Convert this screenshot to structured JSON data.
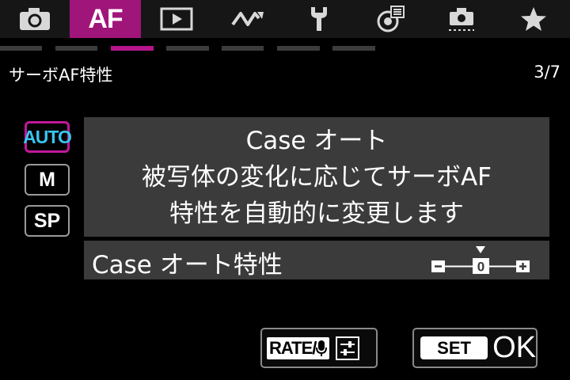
{
  "tabs": [
    {
      "icon": "camera-icon"
    },
    {
      "label": "AF",
      "active": true
    },
    {
      "icon": "playback-icon"
    },
    {
      "icon": "wave-icon"
    },
    {
      "icon": "wrench-icon"
    },
    {
      "icon": "custom-functions-icon"
    },
    {
      "icon": "my-menu-icon"
    },
    {
      "icon": "star-icon"
    }
  ],
  "header": {
    "title": "サーボAF特性",
    "page": "3/7"
  },
  "modes": [
    {
      "label": "AUTO",
      "selected": true
    },
    {
      "label": "M"
    },
    {
      "label": "SP"
    }
  ],
  "description": {
    "title": "Case オート",
    "line1": "被写体の変化に応じてサーボAF",
    "line2": "特性を自動的に変更します"
  },
  "parameter": {
    "label": "Case オート特性",
    "minus": "−",
    "value": "0",
    "plus": "+"
  },
  "buttons": {
    "rate": "RATE/",
    "set": "SET",
    "ok": "OK"
  },
  "colors": {
    "accent": "#a0157a",
    "selected_text": "#39c5f0",
    "panel": "#3b3b3b"
  }
}
